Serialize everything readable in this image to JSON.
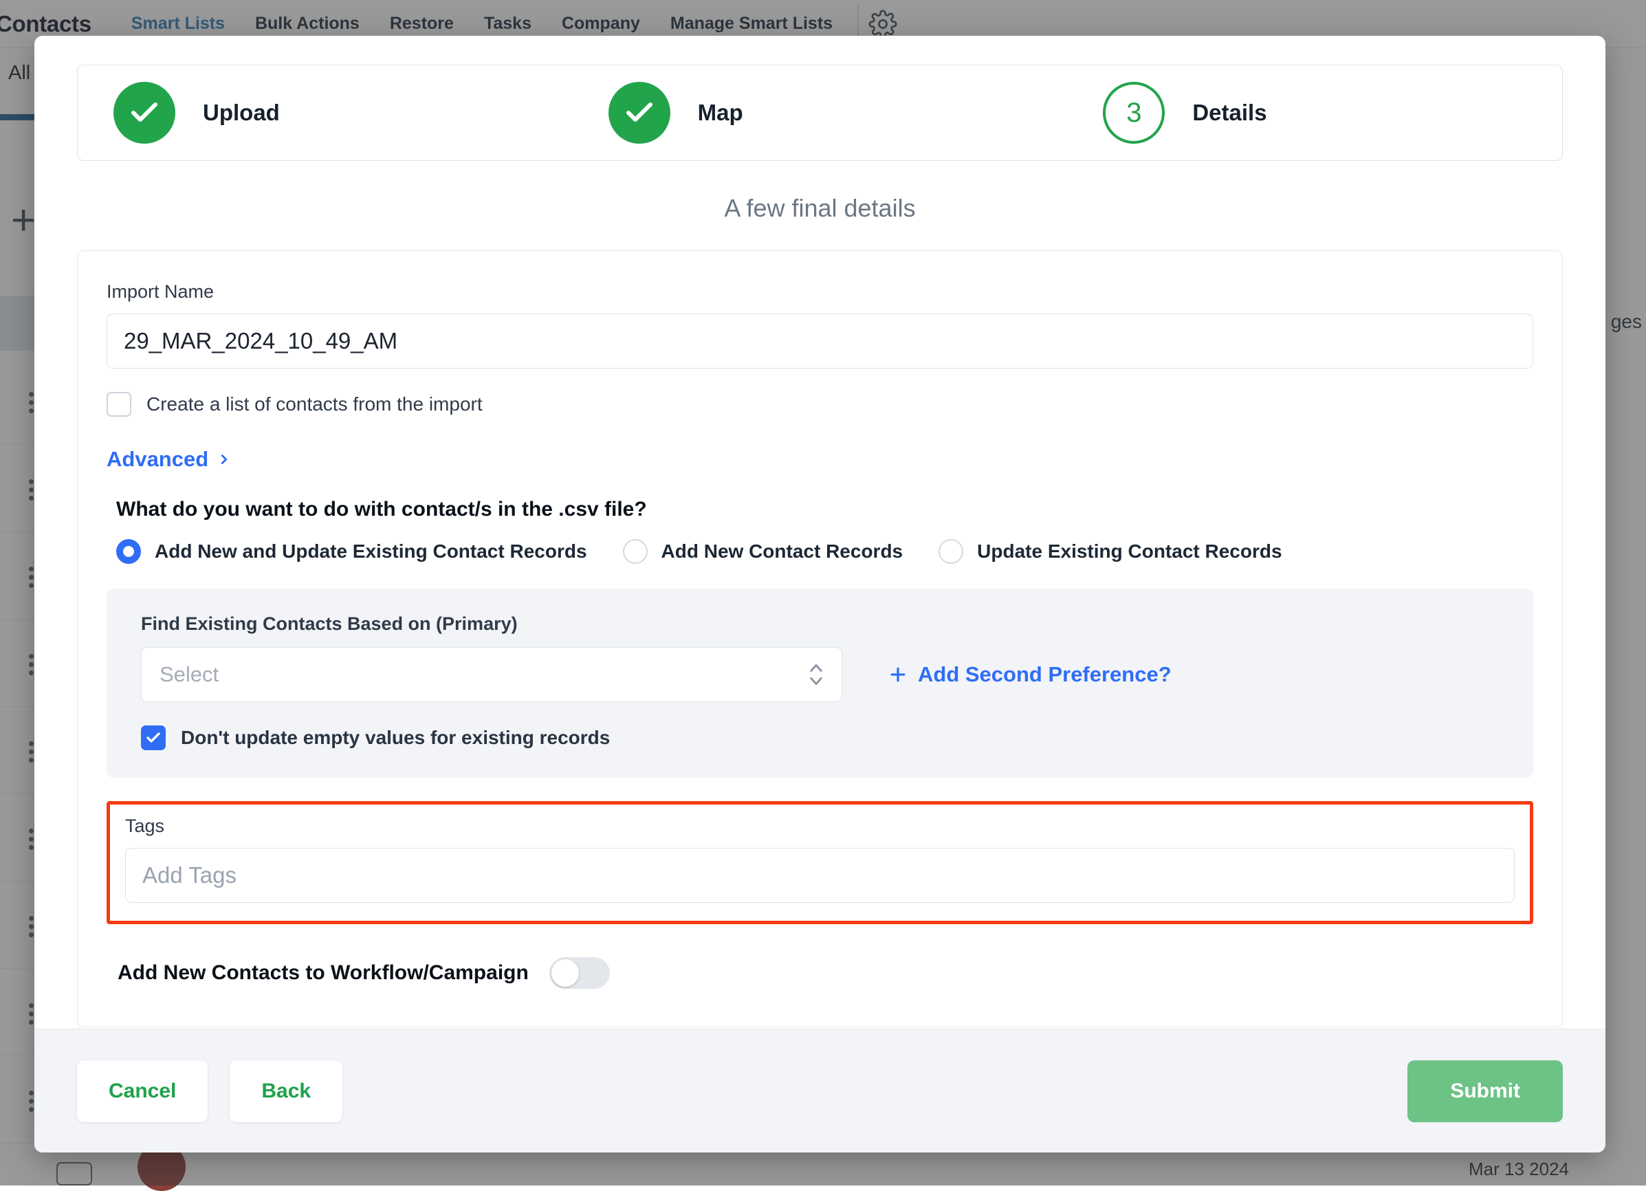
{
  "background": {
    "app_title": "Contacts",
    "nav_items": [
      {
        "label": "Smart Lists",
        "active": true
      },
      {
        "label": "Bulk Actions",
        "active": false
      },
      {
        "label": "Restore",
        "active": false
      },
      {
        "label": "Tasks",
        "active": false
      },
      {
        "label": "Company",
        "active": false
      },
      {
        "label": "Manage Smart Lists",
        "active": false
      }
    ],
    "settings_icon": "gear-icon",
    "tab_all": "All",
    "add_icon": "plus-icon",
    "pages_label": "ges",
    "date_label": "Mar 13 2024"
  },
  "modal": {
    "stepper": [
      {
        "label": "Upload",
        "state": "done",
        "indicator": "check-icon"
      },
      {
        "label": "Map",
        "state": "done",
        "indicator": "check-icon"
      },
      {
        "label": "Details",
        "state": "current",
        "indicator": "3"
      }
    ],
    "heading": "A few final details",
    "import_name": {
      "label": "Import Name",
      "value": "29_MAR_2024_10_49_AM",
      "placeholder": "Import Name"
    },
    "create_list_checkbox": {
      "label": "Create a list of contacts from the import",
      "checked": false
    },
    "advanced": {
      "label": "Advanced",
      "icon": "chevron-right-icon"
    },
    "question": "What do you want to do with contact/s in the .csv file?",
    "radio_options": [
      {
        "label": "Add New and Update Existing Contact Records",
        "selected": true
      },
      {
        "label": "Add New Contact Records",
        "selected": false
      },
      {
        "label": "Update Existing Contact Records",
        "selected": false
      }
    ],
    "find_existing": {
      "label": "Find Existing Contacts Based on (Primary)",
      "select_value": "",
      "select_placeholder": "Select",
      "add_preference_label": "Add Second Preference?",
      "add_preference_icon": "plus-icon",
      "dont_update_checkbox": {
        "label": "Don't update empty values for existing records",
        "checked": true
      }
    },
    "tags": {
      "label": "Tags",
      "value": "",
      "placeholder": "Add Tags",
      "highlight_color": "#f43b12"
    },
    "workflow_toggle": {
      "label": "Add New Contacts to Workflow/Campaign",
      "enabled": false
    },
    "footer": {
      "cancel_label": "Cancel",
      "back_label": "Back",
      "submit_label": "Submit",
      "submit_color": "#6dc286"
    }
  }
}
